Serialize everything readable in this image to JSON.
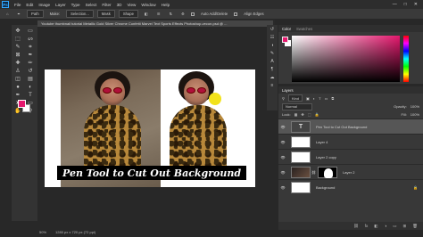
{
  "app": {
    "logo": "Ps"
  },
  "menu": [
    "File",
    "Edit",
    "Image",
    "Layer",
    "Type",
    "Select",
    "Filter",
    "3D",
    "View",
    "Window",
    "Help"
  ],
  "window_controls": [
    "—",
    "□",
    "✕"
  ],
  "options_bar": {
    "mode_label": "Path",
    "buttons": [
      "Make:",
      "Selection...",
      "Mask",
      "Shape"
    ],
    "auto_label": "Auto Add/Delete",
    "align_label": "Align Edges"
  },
  "document": {
    "tab_title": "Youtube thumbnail tutorial Metallic Gold Silver Chrome Confetti Marvel Text Sports Effects Photoshop-vecon.psd @ ...",
    "banner_text": "Pen Tool to Cut Out Background",
    "status_zoom": "50%",
    "status_size": "1280 px x 720 px (72 ppi)"
  },
  "toolbar_icons": [
    "move-icon",
    "artboard-icon",
    "marquee-icon",
    "lasso-icon",
    "quick-select-icon",
    "crop-icon",
    "frame-icon",
    "eyedropper-icon",
    "healing-icon",
    "brush-icon",
    "stamp-icon",
    "history-brush-icon",
    "eraser-icon",
    "gradient-icon",
    "blur-icon",
    "dodge-icon",
    "pen-icon",
    "type-icon",
    "path-select-icon",
    "rectangle-icon",
    "hand-icon",
    "zoom-icon"
  ],
  "toolbar_glyphs": [
    "✥",
    "▭",
    "⬚",
    "ᔕ",
    "✎",
    "⌗",
    "⊠",
    "✒",
    "✚",
    "✏",
    "♙",
    "↺",
    "◫",
    "▤",
    "●",
    "◐",
    "✒",
    "T",
    "➤",
    "▭",
    "✋",
    "⚲"
  ],
  "colors": {
    "foreground": "#e5186e",
    "background": "#ffffff",
    "accent": "#31a8ff"
  },
  "color_panel": {
    "tabs": [
      "Color",
      "Swatches"
    ]
  },
  "layers_panel": {
    "title": "Layers",
    "kind_label": "Kind",
    "blend_mode": "Normal",
    "opacity_label": "Opacity:",
    "opacity_value": "100%",
    "lock_label": "Lock:",
    "fill_label": "Fill:",
    "fill_value": "100%",
    "layers": [
      {
        "name": "Pen Tool to Cut Out Background",
        "thumb": "T",
        "type": "text",
        "selected": true
      },
      {
        "name": "Layer 4",
        "thumb": "",
        "type": "plain",
        "selected": false
      },
      {
        "name": "Layer 2 copy",
        "thumb": "",
        "type": "plain",
        "selected": false
      },
      {
        "name": "Layer 2",
        "thumb": "",
        "type": "masked",
        "selected": false
      },
      {
        "name": "Background",
        "thumb": "",
        "type": "plain",
        "selected": false
      }
    ],
    "footer_icons": [
      "link-icon",
      "fx-icon",
      "mask-icon",
      "adjustment-icon",
      "group-icon",
      "new-layer-icon",
      "trash-icon"
    ],
    "footer_glyphs": [
      "⛓",
      "fx",
      "◧",
      "◑",
      "▭",
      "⊞",
      "🗑"
    ]
  }
}
